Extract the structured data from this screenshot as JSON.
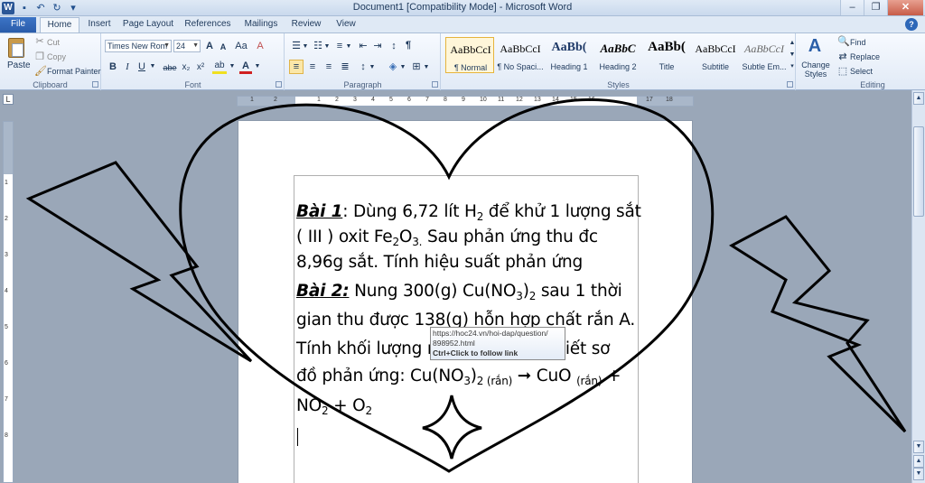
{
  "window": {
    "title": "Document1 [Compatibility Mode] - Microsoft Word",
    "logo": "W",
    "controls": {
      "minimize": "–",
      "maximize": "❐",
      "close": "✕"
    }
  },
  "tabs": [
    "File",
    "Home",
    "Insert",
    "Page Layout",
    "References",
    "Mailings",
    "Review",
    "View"
  ],
  "ribbon": {
    "clipboard": {
      "label": "Clipboard",
      "paste": "Paste",
      "cut": "Cut",
      "copy": "Copy",
      "format_painter": "Format Painter"
    },
    "font": {
      "label": "Font",
      "font_name": "Times New Rom",
      "font_size": "24",
      "bold": "B",
      "italic": "I",
      "underline": "U",
      "strike": "abe",
      "subscript": "x₂",
      "superscript": "x²",
      "text_highlight": "ab",
      "font_color": "A",
      "grow": "A",
      "shrink": "A",
      "change_case": "Aa",
      "clear": "A"
    },
    "paragraph": {
      "label": "Paragraph",
      "pilcrow": "¶"
    },
    "styles": {
      "label": "Styles",
      "items": [
        {
          "sample": "AaBbCcI",
          "name": "¶ Normal"
        },
        {
          "sample": "AaBbCcI",
          "name": "¶ No Spaci..."
        },
        {
          "sample": "AaBb(",
          "name": "Heading 1"
        },
        {
          "sample": "AaBbC",
          "name": "Heading 2"
        },
        {
          "sample": "AaBb(",
          "name": "Title"
        },
        {
          "sample": "AaBbCcI",
          "name": "Subtitle"
        },
        {
          "sample": "AaBbCcI",
          "name": "Subtle Em..."
        }
      ],
      "change_styles": "Change Styles"
    },
    "editing": {
      "label": "Editing",
      "find": "Find",
      "replace": "Replace",
      "select": "Select"
    }
  },
  "ruler": {
    "numbers": [
      "1",
      "2",
      "1",
      "2",
      "3",
      "4",
      "5",
      "6",
      "7",
      "8",
      "9",
      "10",
      "11",
      "12",
      "13",
      "14",
      "15",
      "16",
      "17",
      "18"
    ]
  },
  "document": {
    "bai1_label": "Bài 1",
    "line1_a": ": Dùng 6,72 lít H",
    "line1_sub": "2",
    "line1_b": " để khử 1 lượng sắt",
    "line2_a": "( III ) oxit Fe",
    "line2_sub1": "2",
    "line2_b": "O",
    "line2_sub2": "3.",
    "line2_c": " Sau phản ứng thu đc",
    "line3": "8,96g sắt. Tính hiệu suất phản ứng",
    "bai2_label": "Bài 2:",
    "line4_a": "  Nung 300(g) Cu(NO",
    "line4_sub": "3",
    "line4_b": ")",
    "line4_sub2": "2",
    "line4_c": " sau 1 thời",
    "line5": "gian thu được 138(g) hỗn hợp chất rắn A.",
    "line6_a": "Tính khối lượng r",
    "line6_b": "biết sơ",
    "line7_a": "đồ phản ứng: Cu(NO",
    "line7_sub": "3",
    "line7_b": ")",
    "line7_sub2": "2 (rắn)",
    "line7_c": " ➞ CuO ",
    "line7_sub3": "(rắn)",
    "line7_d": " +",
    "line8_a": "NO",
    "line8_sub": "2",
    "line8_b": " + O",
    "line8_sub2": "2"
  },
  "tooltip": {
    "url_line1": "https://hoc24.vn/hoi-dap/question/",
    "url_line2": "898952.html",
    "hint": "Ctrl+Click to follow link"
  }
}
